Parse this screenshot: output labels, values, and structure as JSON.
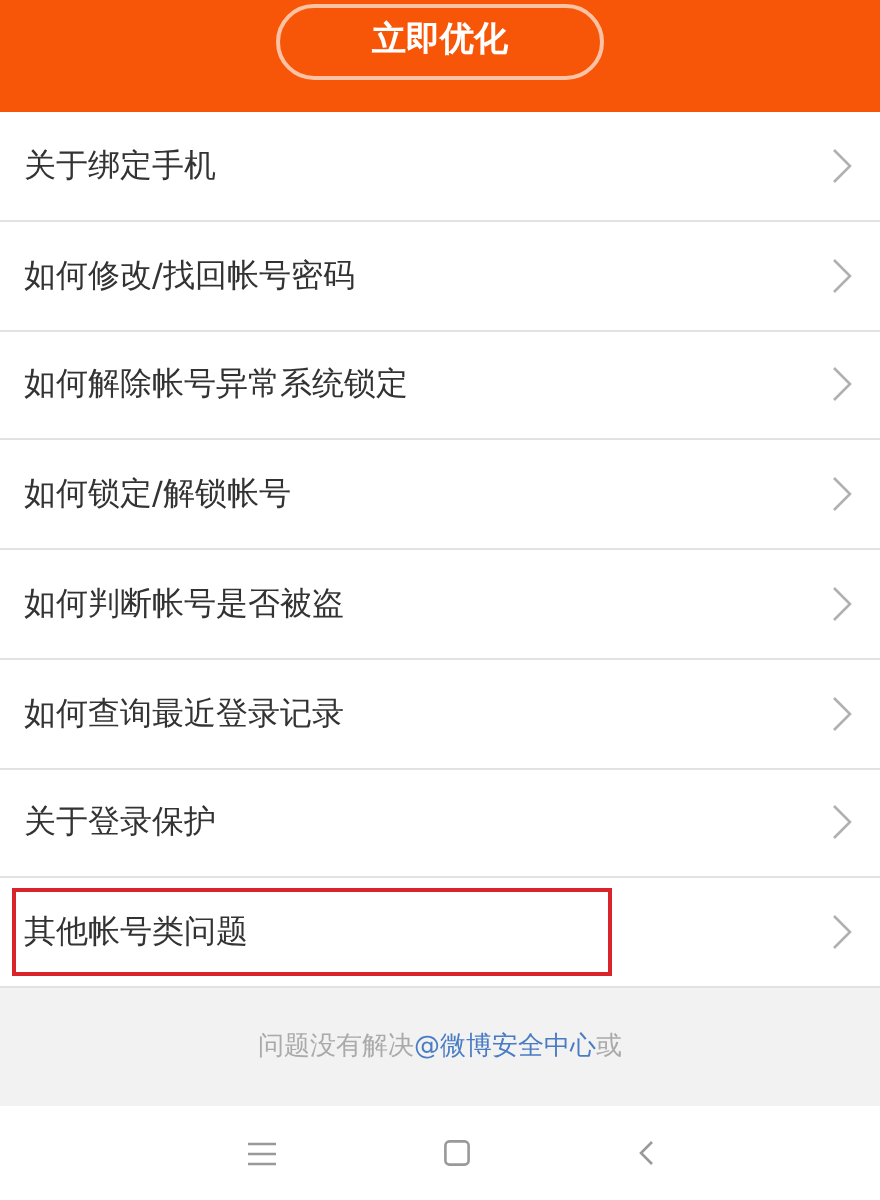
{
  "header": {
    "button": "立即优化"
  },
  "items": [
    {
      "label": "关于绑定手机",
      "highlighted": false
    },
    {
      "label": "如何修改/找回帐号密码",
      "highlighted": false
    },
    {
      "label": "如何解除帐号异常系统锁定",
      "highlighted": false
    },
    {
      "label": "如何锁定/解锁帐号",
      "highlighted": false
    },
    {
      "label": "如何判断帐号是否被盗",
      "highlighted": false
    },
    {
      "label": "如何查询最近登录记录",
      "highlighted": false
    },
    {
      "label": "关于登录保护",
      "highlighted": false
    },
    {
      "label": "其他帐号类问题",
      "highlighted": true
    }
  ],
  "footer": {
    "text": "问题没有解决",
    "link": "@微博安全中心",
    "after": "或"
  },
  "nav_bar": [
    {
      "kind": "menu"
    },
    {
      "kind": "home"
    },
    {
      "kind": "back"
    }
  ]
}
